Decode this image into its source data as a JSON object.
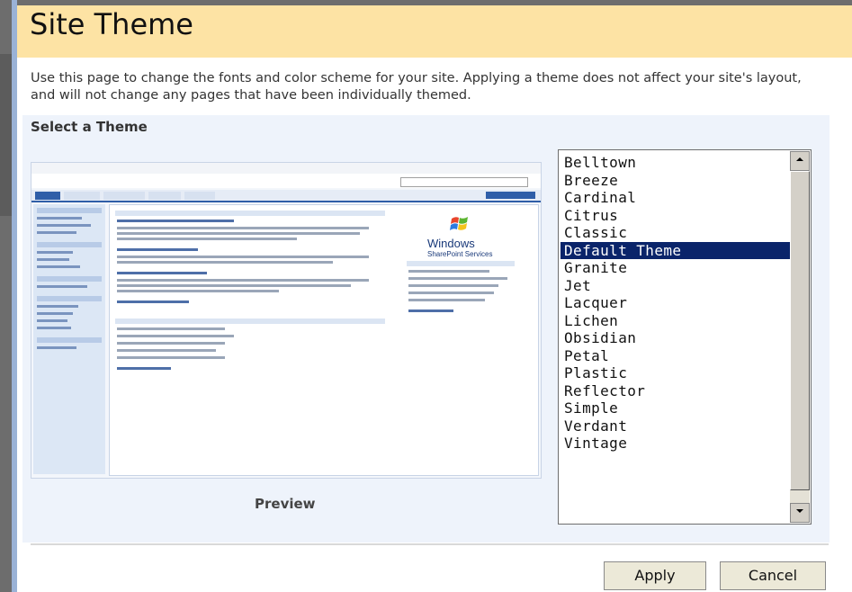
{
  "header": {
    "title": "Site Theme"
  },
  "description": "Use this page to change the fonts and color scheme for your site. Applying a theme does not affect your site's layout, and will not change any pages that have been individually themed.",
  "section": {
    "label": "Select a Theme"
  },
  "preview": {
    "caption": "Preview",
    "logo_text": "Windows",
    "logo_subtext": "SharePoint Services"
  },
  "themes": {
    "items": [
      "Belltown",
      "Breeze",
      "Cardinal",
      "Citrus",
      "Classic",
      "Default Theme",
      "Granite",
      "Jet",
      "Lacquer",
      "Lichen",
      "Obsidian",
      "Petal",
      "Plastic",
      "Reflector",
      "Simple",
      "Verdant",
      "Vintage"
    ],
    "selected": "Default Theme"
  },
  "buttons": {
    "apply": "Apply",
    "cancel": "Cancel"
  },
  "colors": {
    "title_bar": "#fde3a4",
    "selection": "#0a246a",
    "panel": "#eef3fb"
  }
}
